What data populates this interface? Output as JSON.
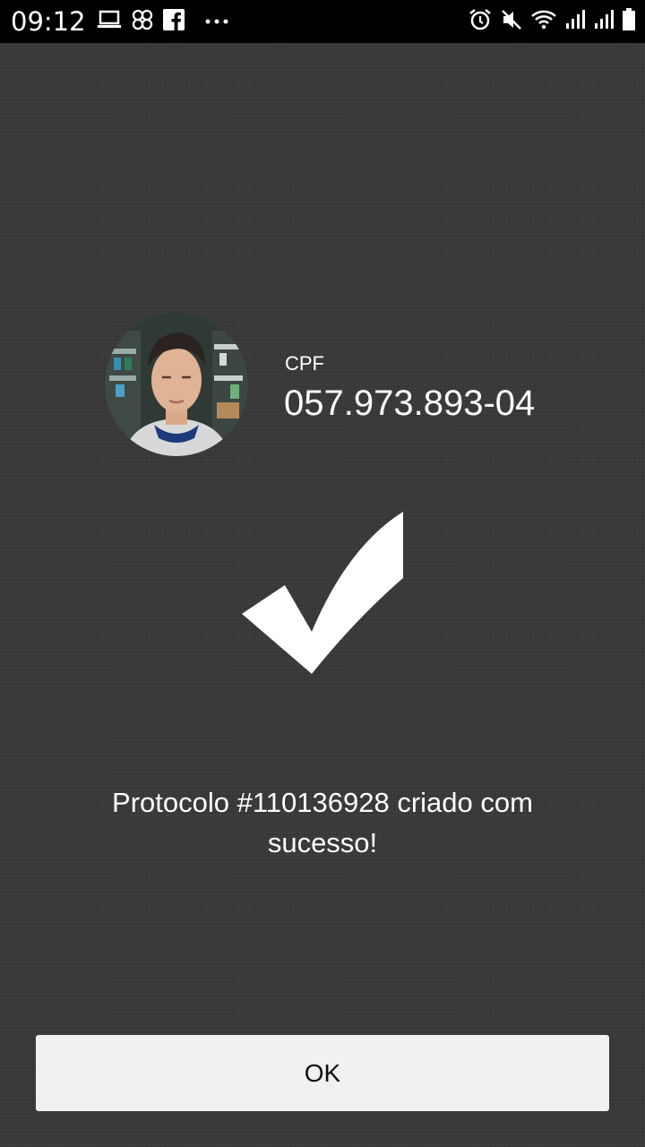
{
  "status_bar": {
    "time": "09:12",
    "left_icons": [
      "laptop-icon",
      "pinwheel-icon",
      "facebook-icon",
      "more-dots-icon"
    ],
    "right_icons": [
      "alarm-icon",
      "mute-icon",
      "wifi-icon",
      "signal-1-icon",
      "signal-2-icon",
      "battery-icon"
    ]
  },
  "user": {
    "avatar": "user-photo",
    "cpf_label": "CPF",
    "cpf_value": "057.973.893-04"
  },
  "success_icon": "checkmark-icon",
  "message": "Protocolo #110136928 criado com sucesso!",
  "ok_button": {
    "label": "OK"
  },
  "colors": {
    "background": "#3d3d3d",
    "status_bar": "#000000",
    "button": "#f1f1f1",
    "text": "#ffffff"
  }
}
